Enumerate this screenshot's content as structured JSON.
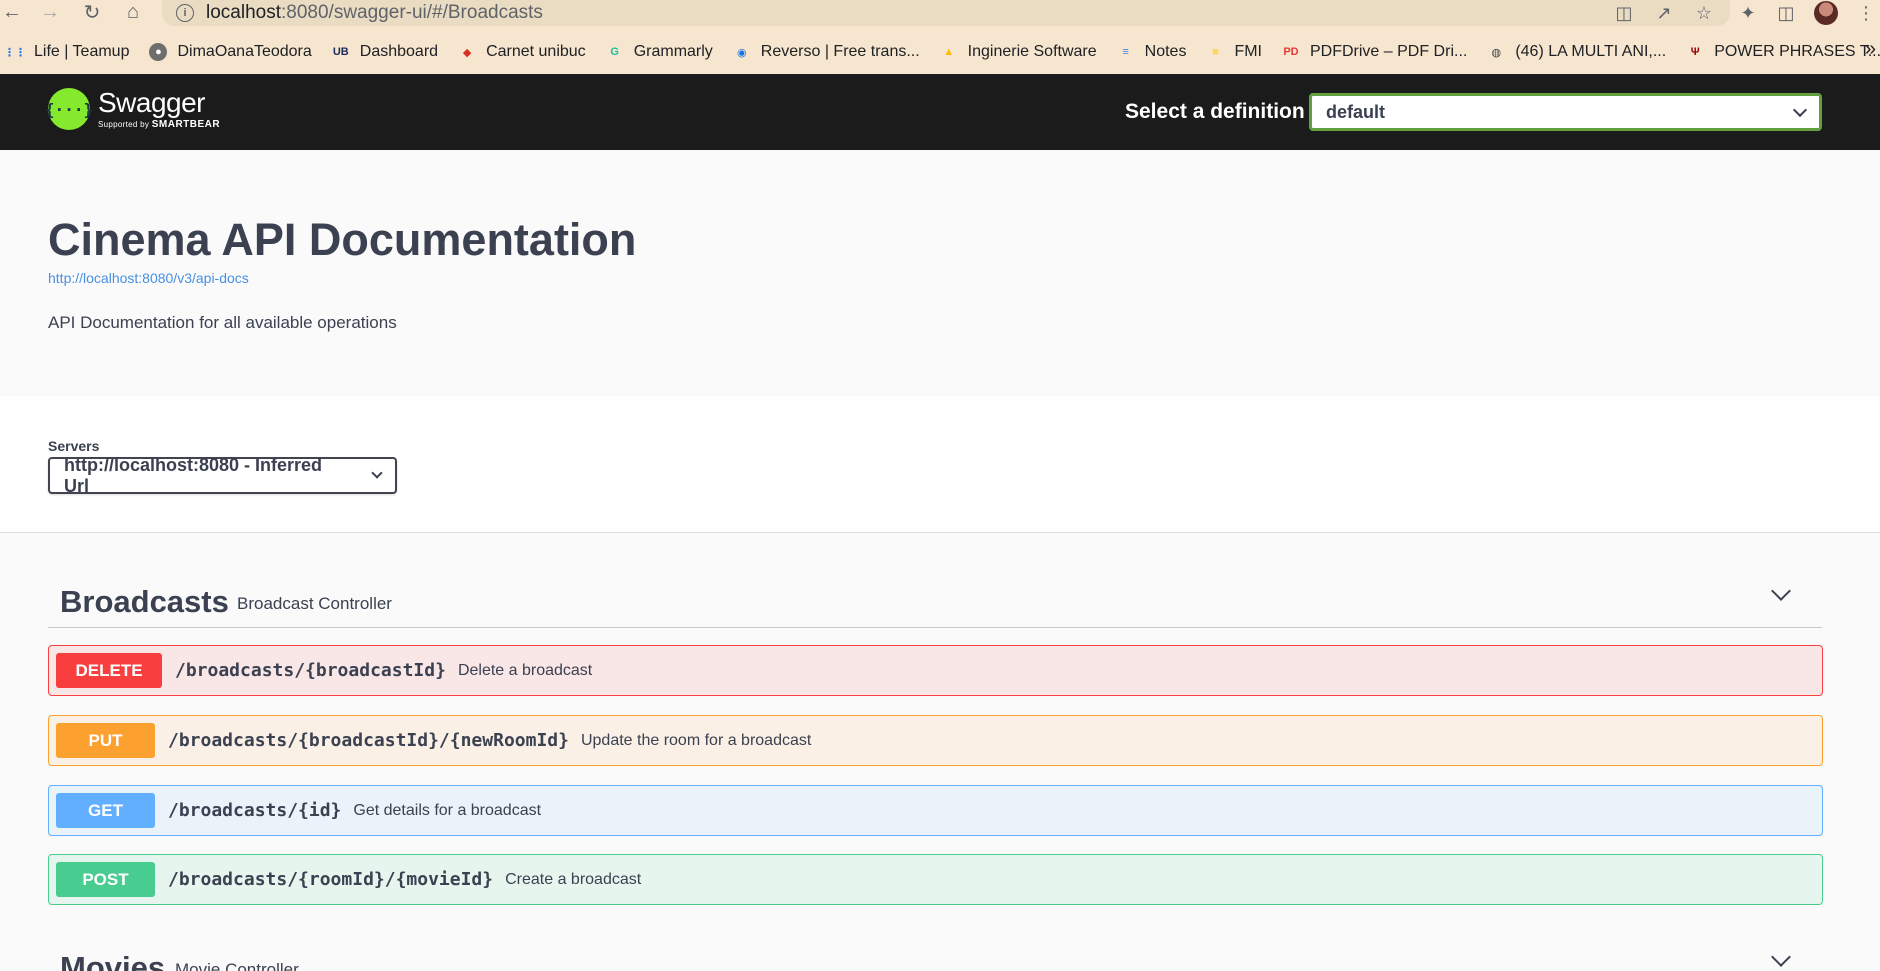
{
  "browser": {
    "url_host": "localhost",
    "url_path": ":8080/swagger-ui/#/Broadcasts",
    "bookmarks": [
      {
        "label": "Life | Teamup",
        "icon": "grid-icon",
        "color": "#1a73e8"
      },
      {
        "label": "DimaOanaTeodora",
        "icon": "github-icon",
        "color": "#ffffff"
      },
      {
        "label": "Dashboard",
        "icon": "ub-icon",
        "color": "#1a2b5c"
      },
      {
        "label": "Carnet unibuc",
        "icon": "kite-icon",
        "color": "#d93025"
      },
      {
        "label": "Grammarly",
        "icon": "grammarly-icon",
        "color": "#15c39a"
      },
      {
        "label": "Reverso | Free trans...",
        "icon": "reverso-icon",
        "color": "#1a73e8"
      },
      {
        "label": "Inginerie Software",
        "icon": "drive-icon",
        "color": "#fbbc04"
      },
      {
        "label": "Notes",
        "icon": "docs-icon",
        "color": "#4285f4"
      },
      {
        "label": "FMI",
        "icon": "folder-icon",
        "color": "#fbd75b"
      },
      {
        "label": "PDFDrive – PDF Dri...",
        "icon": "pdfdrive-icon",
        "color": "#e53935"
      },
      {
        "label": "(46) LA MULTI ANI,...",
        "icon": "globe-icon",
        "color": "#3c4043"
      },
      {
        "label": "POWER PHRASES T...",
        "icon": "iu-icon",
        "color": "#990000"
      }
    ],
    "more": "»"
  },
  "topbar": {
    "logo_name": "Swagger",
    "logo_tagline": "Supported by",
    "logo_brand": "SMARTBEAR",
    "definition_label": "Select a definition",
    "definition_value": "default",
    "accent": "#85ea2d"
  },
  "info": {
    "title": "Cinema API Documentation",
    "docs_url": "http://localhost:8080/v3/api-docs",
    "description": "API Documentation for all available operations"
  },
  "servers": {
    "label": "Servers",
    "selected": "http://localhost:8080 - Inferred Url"
  },
  "tags": [
    {
      "name": "Broadcasts",
      "description": "Broadcast Controller",
      "operations": [
        {
          "method": "DELETE",
          "path": "/broadcasts/{broadcastId}",
          "summary": "Delete a broadcast"
        },
        {
          "method": "PUT",
          "path": "/broadcasts/{broadcastId}/{newRoomId}",
          "summary": "Update the room for a broadcast"
        },
        {
          "method": "GET",
          "path": "/broadcasts/{id}",
          "summary": "Get details for a broadcast"
        },
        {
          "method": "POST",
          "path": "/broadcasts/{roomId}/{movieId}",
          "summary": "Create a broadcast"
        }
      ]
    },
    {
      "name": "Movies",
      "description": "Movie Controller",
      "operations": []
    }
  ],
  "colors": {
    "delete": "#f93e3e",
    "put": "#fca130",
    "get": "#61affe",
    "post": "#49cc90"
  }
}
